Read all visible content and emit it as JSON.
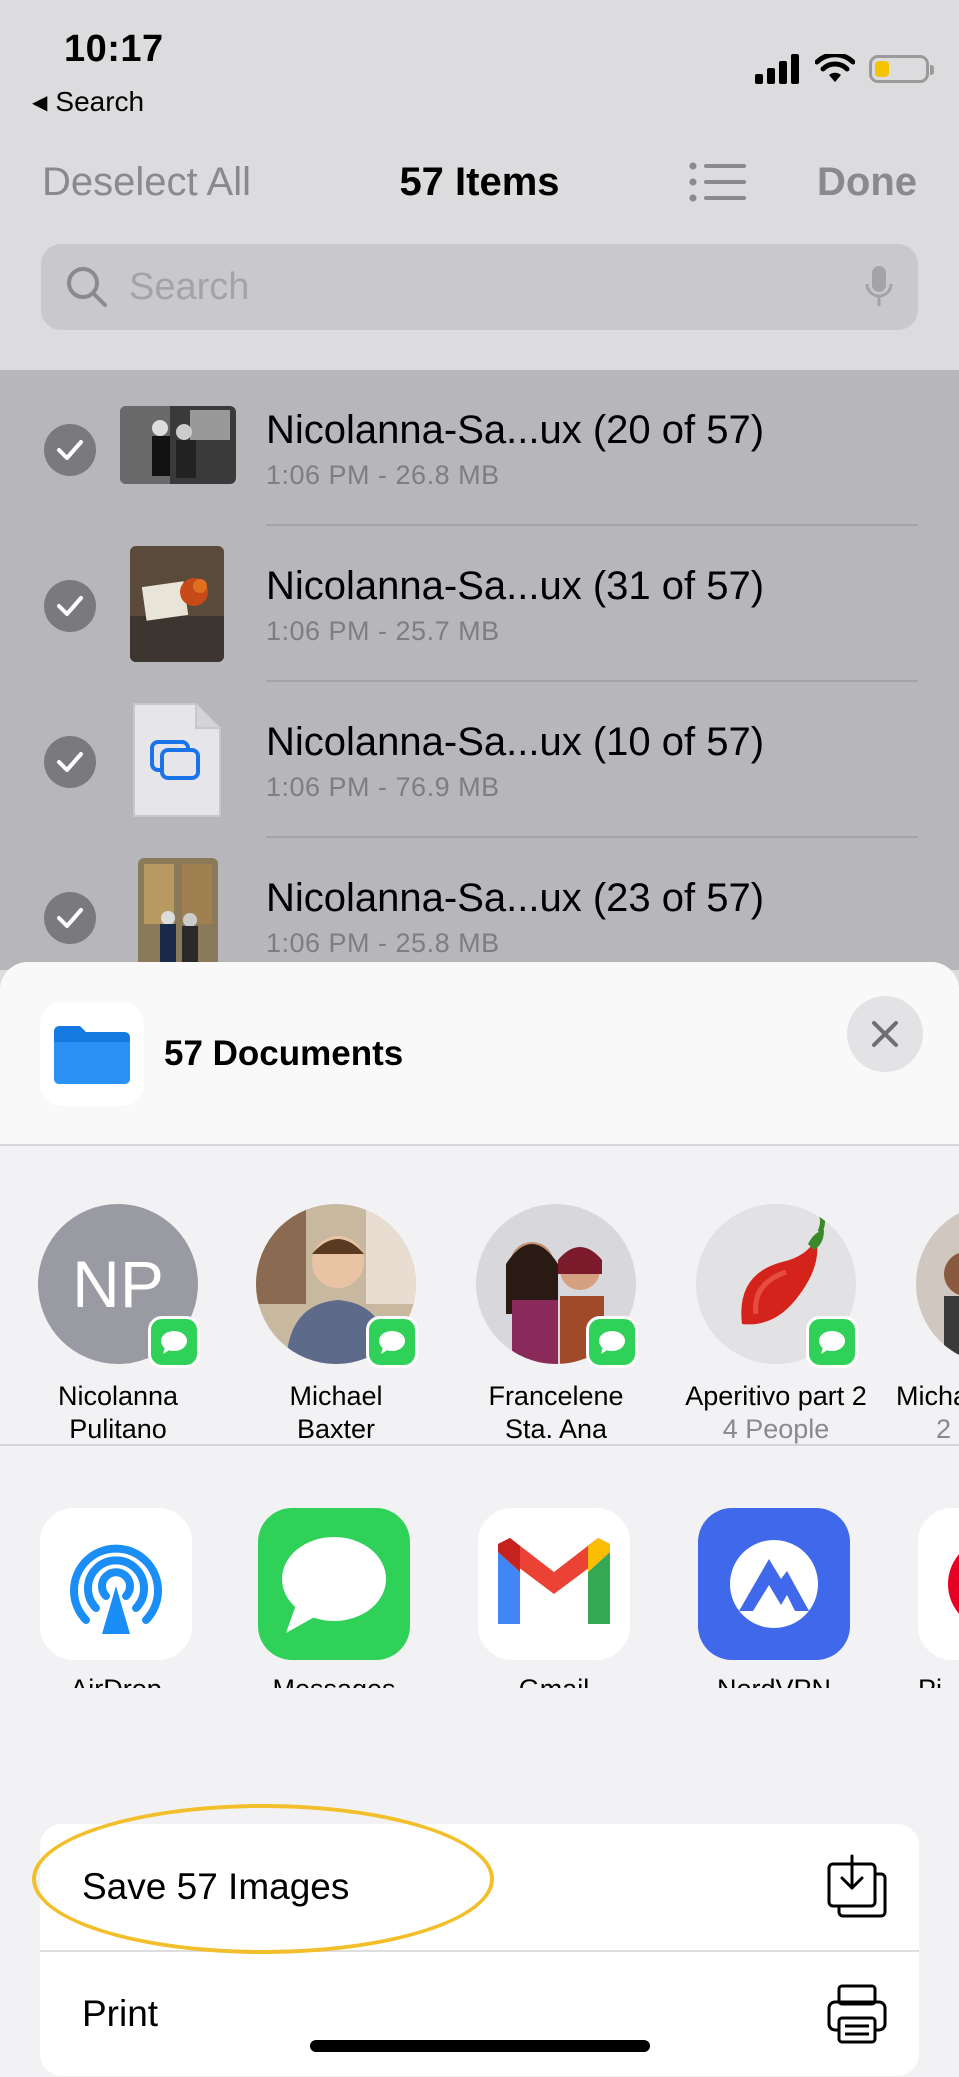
{
  "status": {
    "time": "10:17",
    "back_label": "Search"
  },
  "nav": {
    "deselect_label": "Deselect All",
    "title": "57 Items",
    "done_label": "Done"
  },
  "search": {
    "placeholder": "Search"
  },
  "files": [
    {
      "name": "Nicolanna-Sa...ux (20 of 57)",
      "meta": "1:06 PM - 26.8 MB"
    },
    {
      "name": "Nicolanna-Sa...ux (31 of 57)",
      "meta": "1:06 PM - 25.7 MB"
    },
    {
      "name": "Nicolanna-Sa...ux (10 of 57)",
      "meta": "1:06 PM - 76.9 MB"
    },
    {
      "name": "Nicolanna-Sa...ux (23 of 57)",
      "meta": "1:06 PM - 25.8 MB"
    }
  ],
  "sheet": {
    "title": "57 Documents",
    "people": [
      {
        "name_line1": "Nicolanna",
        "name_line2": "Pulitano",
        "initials": "NP"
      },
      {
        "name_line1": "Michael",
        "name_line2": "Baxter"
      },
      {
        "name_line1": "Francelene",
        "name_line2": "Sta. Ana"
      },
      {
        "name_line1": "Aperitivo part 2",
        "name_line2": "4 People",
        "emoji": "🌶️"
      },
      {
        "name_line1": "Micha",
        "name_line2": "2"
      }
    ],
    "apps": [
      {
        "label": "AirDrop"
      },
      {
        "label": "Messages"
      },
      {
        "label": "Gmail"
      },
      {
        "label": "NordVPN"
      },
      {
        "label": "Pi"
      }
    ],
    "actions": [
      {
        "label": "Save 57 Images"
      },
      {
        "label": "Print"
      }
    ]
  },
  "colors": {
    "accent_blue": "#1a73e8",
    "messages_green": "#30d158",
    "highlight": "#f2bf2a",
    "nord_blue": "#4068ea"
  }
}
